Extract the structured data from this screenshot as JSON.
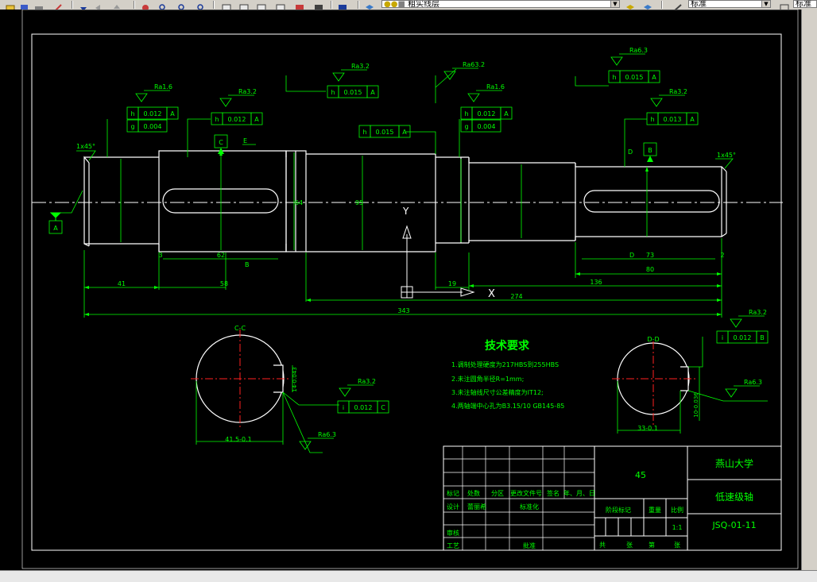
{
  "toolbar": {
    "layer_combo": "粗实线层",
    "style_combo": "标准",
    "style_combo2": "标准"
  },
  "drawing": {
    "roughness": {
      "r1": "Ra1.6",
      "r2": "Ra3.2",
      "r3": "Ra3.2",
      "r4": "Ra63.2",
      "r5": "Ra1.6",
      "r6": "Ra6.3",
      "r7": "Ra3.2",
      "r8": "Ra3.2",
      "r9": "Ra3.2",
      "r10": "Ra6.3",
      "r11": "Ra6.3"
    },
    "fcf": {
      "f1a": [
        "h",
        "0.012",
        "A"
      ],
      "f1b": [
        "g",
        "0.004",
        ""
      ],
      "f2": [
        "h",
        "0.012",
        "A"
      ],
      "f3": [
        "h",
        "0.015",
        "A"
      ],
      "f4": [
        "h",
        "0.015",
        "A"
      ],
      "f5a": [
        "h",
        "0.012",
        "A"
      ],
      "f5b": [
        "g",
        "0.004",
        ""
      ],
      "f6": [
        "h",
        "0.015",
        "A"
      ],
      "f7": [
        "h",
        "0.013",
        "A"
      ],
      "f8": [
        "i",
        "0.012",
        "C"
      ],
      "f9": [
        "i",
        "0.012",
        "B"
      ]
    },
    "datums": {
      "a": "A",
      "b": "B",
      "c": "C"
    },
    "chamfer_left": "1x45°",
    "chamfer_right": "1x45°",
    "dims": {
      "d62": "62",
      "d41": "41",
      "d58": "58",
      "d343": "343",
      "d19": "19",
      "d274": "274",
      "d136": "136",
      "d73": "73",
      "d80": "80",
      "d2": "2",
      "d3": "3",
      "d95": "95",
      "d64": "64"
    },
    "section_labels": {
      "c": "C-C",
      "d": "D-D"
    },
    "section_dims": {
      "c_w": "41.5-0.1",
      "c_h": "14-0.043",
      "d_w": "33-0.1",
      "d_h": "10-0.036"
    },
    "leader_labels": {
      "b": "B",
      "e": "E",
      "d": "D",
      "d2": "D"
    },
    "axis": {
      "x": "X",
      "y": "Y"
    },
    "tech": {
      "title": "技术要求",
      "items": [
        "1.调制处理硬度为217HBS到255HBS",
        "2.未注圆角半径R=1mm;",
        "3.未注轴线尺寸公差精度为IT12;",
        "4.两轴端中心孔为B3.15/10 GB145-85"
      ]
    },
    "title_block": {
      "material": "45",
      "school": "燕山大学",
      "part_name": "低速级轴",
      "drawing_no": "JSQ-01-11",
      "scale": "1:1",
      "row_labels": [
        "标记",
        "处数",
        "分区",
        "更改文件号",
        "签名",
        "年、月、日"
      ],
      "design": "设计",
      "designer": "蕾丽希",
      "standard": "标准化",
      "stage_mark": "阶段标记",
      "weight": "重量",
      "ratio": "比例",
      "review": "审核",
      "process": "工艺",
      "approve": "批准",
      "sheets": [
        "共",
        "张",
        "第",
        "张"
      ]
    }
  }
}
